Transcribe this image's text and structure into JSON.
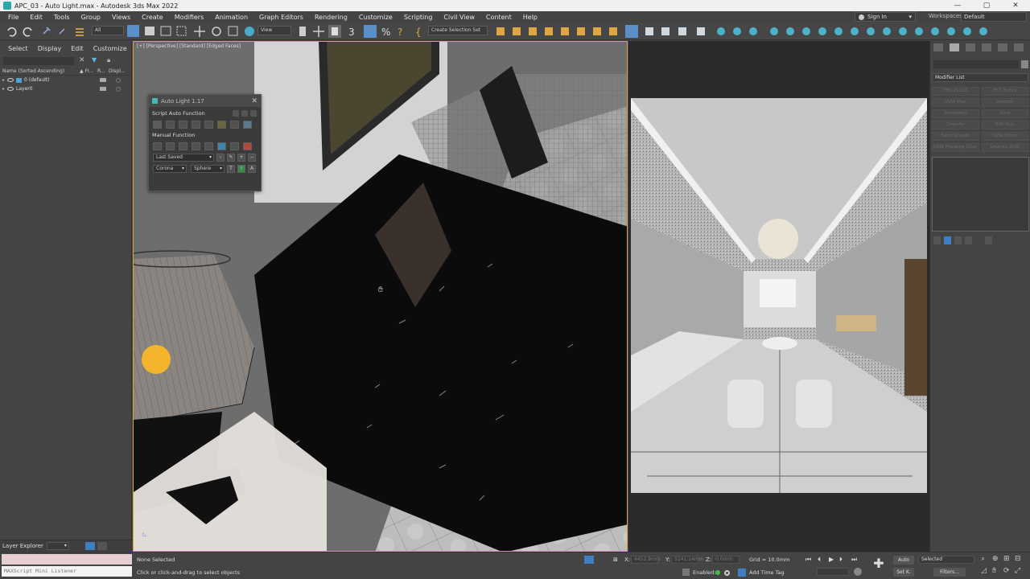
{
  "window": {
    "title": "APC_03 - Auto Light.max - Autodesk 3ds Max 2022",
    "controls": [
      "—",
      "▢",
      "✕"
    ]
  },
  "menu": {
    "items": [
      "File",
      "Edit",
      "Tools",
      "Group",
      "Views",
      "Create",
      "Modifiers",
      "Animation",
      "Graph Editors",
      "Rendering",
      "Customize",
      "Scripting",
      "Civil View",
      "Content",
      "Help"
    ],
    "sign_in": "Sign In",
    "workspaces_label": "Workspaces:",
    "workspace_value": "Default"
  },
  "toolbar": {
    "filter_value": "All",
    "view_value": "View",
    "selection_set_placeholder": "Create Selection Set"
  },
  "scene_explorer": {
    "tabs": [
      "Select",
      "Display",
      "Edit",
      "Customize"
    ],
    "columns": [
      "Name (Sorted Ascending)",
      "▲ Fr...",
      "R...",
      "Displ..."
    ],
    "layers": [
      {
        "name": "0 (default)"
      },
      {
        "name": "Layer0"
      }
    ],
    "footer_label": "Layer Explorer"
  },
  "viewport_left": {
    "label": "[+] [Perspective] [Standard] [Edged Faces]"
  },
  "auto_light": {
    "title": "Auto Light 1.17",
    "section_script": "Script Auto Function",
    "section_manual": "Manual Function",
    "preset_value": "Last Saved",
    "renderer_value": "Corona",
    "shape_value": "Sphere"
  },
  "command_panel": {
    "modifier_list": "Modifier List",
    "modifiers": [
      "FFD 2x2x2",
      "FFD 3x3x3",
      "UVW Map",
      "Smooth",
      "Symmetry",
      "Slice",
      "Chamfer",
      "Edit Poly",
      "TurboSmooth",
      "UVW Xform",
      "UVW Mapping Clear",
      "Unwrap UVW"
    ]
  },
  "status": {
    "maxscript_placeholder": "MAXScript Mini Listener",
    "selection": "None Selected",
    "prompt": "Click or click-and-drag to select objects",
    "x_label": "X:",
    "x_value": "4452.9mm",
    "y_label": "Y:",
    "y_value": "5141.14mm",
    "z_label": "Z:",
    "z_value": "0.0mm",
    "grid": "Grid = 10.0mm",
    "enabled_label": "Enabled:",
    "add_time_tag": "Add Time Tag",
    "auto_label": "Auto",
    "setk_label": "Set K.",
    "selected_value": "Selected",
    "filters_label": "Filters..."
  }
}
